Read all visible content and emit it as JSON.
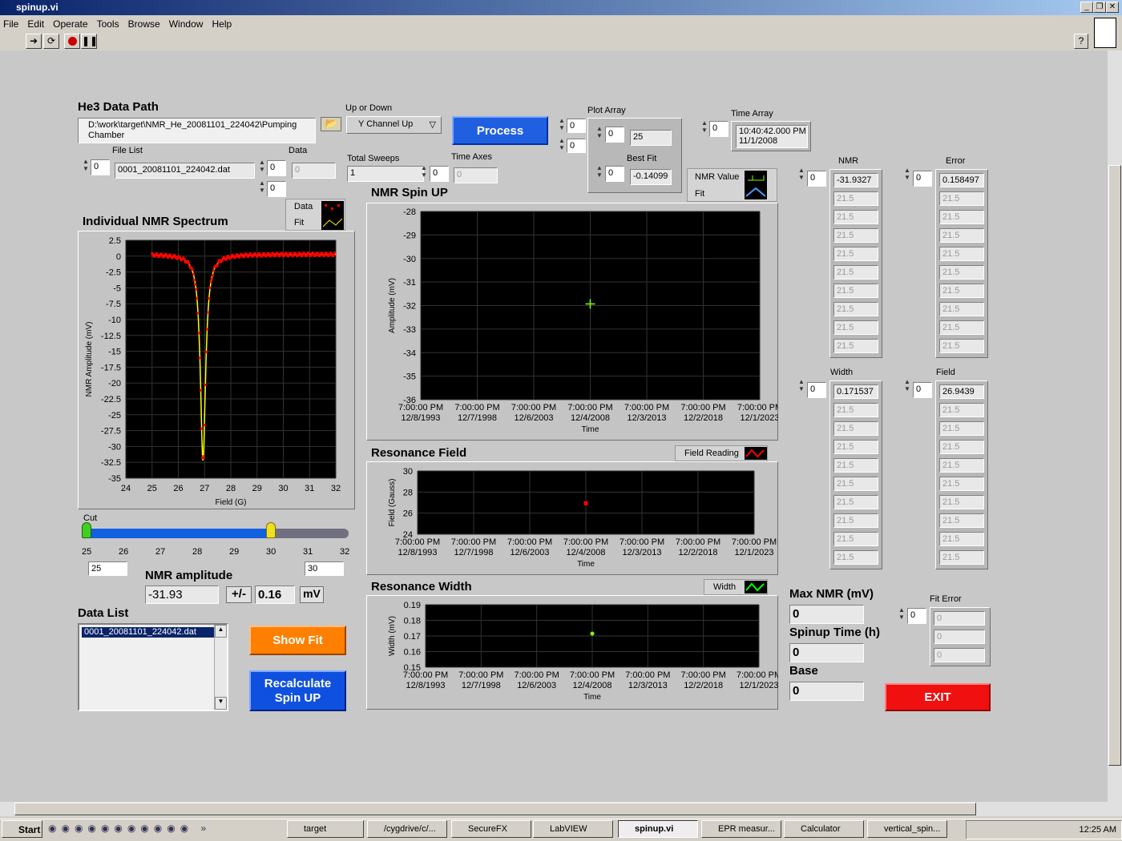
{
  "window": {
    "title": "spinup.vi",
    "min": "_",
    "max": "❐",
    "close": "✕"
  },
  "menu": [
    "File",
    "Edit",
    "Operate",
    "Tools",
    "Browse",
    "Window",
    "Help"
  ],
  "he3": {
    "title": "He3 Data Path",
    "path": "D:\\work\\target\\NMR_He_20081101_224042\\Pumping Chamber"
  },
  "file_list": {
    "label": "File List",
    "index": "0",
    "value": "0001_20081101_224042.dat"
  },
  "data_ctl": {
    "label": "Data",
    "i1": "0",
    "i2": "0",
    "value": "0"
  },
  "up_down": {
    "label": "Up or Down",
    "value": "Y Channel Up"
  },
  "total_sweeps": {
    "label": "Total Sweeps",
    "value": "1"
  },
  "time_axes": {
    "label": "Time Axes",
    "index": "0",
    "value": "0"
  },
  "process": "Process",
  "small_idx": [
    "0",
    "0"
  ],
  "plot_array": {
    "label": "Plot Array",
    "index": "0",
    "value": "25",
    "best_fit_label": "Best Fit",
    "bf_index": "0",
    "best_fit": "-0.14099"
  },
  "time_array": {
    "label": "Time Array",
    "index": "0",
    "value1": "10:40:42.000 PM",
    "value2": "11/1/2008"
  },
  "nmr_legend": {
    "a": "NMR Value",
    "b": "Fit"
  },
  "spectrum": {
    "title": "Individual NMR Spectrum",
    "legend_data": "Data",
    "legend_fit": "Fit",
    "xlabel": "Field (G)",
    "ylabel": "NMR Amplitude (mV)",
    "xticks": [
      "24",
      "25",
      "26",
      "27",
      "28",
      "29",
      "30",
      "31",
      "32"
    ],
    "yticks": [
      "2.5",
      "0",
      "-2.5",
      "-5",
      "-7.5",
      "-10",
      "-12.5",
      "-15",
      "-17.5",
      "-20",
      "-22.5",
      "-25",
      "-27.5",
      "-30",
      "-32.5",
      "-35"
    ]
  },
  "cut": {
    "label": "Cut",
    "ticks": [
      "25",
      "26",
      "27",
      "28",
      "29",
      "30",
      "31",
      "32"
    ],
    "low": "25",
    "high": "30"
  },
  "nmr_amp": {
    "label": "NMR amplitude",
    "value": "-31.93",
    "pm": "+/-",
    "err": "0.16",
    "unit": "mV"
  },
  "data_list": {
    "label": "Data List",
    "item": "0001_20081101_224042.dat"
  },
  "show_fit": "Show Fit",
  "recalc": [
    "Recalculate",
    "Spin UP"
  ],
  "spinup_chart": {
    "title": "NMR Spin UP",
    "ylabel": "Amplitude (mV)",
    "xlabel": "Time",
    "yticks": [
      "-28",
      "-29",
      "-30",
      "-31",
      "-32",
      "-33",
      "-34",
      "-35",
      "-36"
    ],
    "xticks": [
      [
        "7:00:00 PM",
        "12/8/1993"
      ],
      [
        "7:00:00 PM",
        "12/7/1998"
      ],
      [
        "7:00:00 PM",
        "12/6/2003"
      ],
      [
        "7:00:00 PM",
        "12/4/2008"
      ],
      [
        "7:00:00 PM",
        "12/3/2013"
      ],
      [
        "7:00:00 PM",
        "12/2/2018"
      ],
      [
        "7:00:00 PM",
        "12/1/2023"
      ]
    ]
  },
  "field_chart": {
    "title": "Resonance Field",
    "legend": "Field Reading",
    "ylabel": "Field (Gauss)",
    "xlabel": "Time",
    "yticks": [
      "30",
      "28",
      "26",
      "24"
    ]
  },
  "width_chart": {
    "title": "Resonance Width",
    "legend": "Width",
    "ylabel": "Width (mV)",
    "xlabel": "Time",
    "yticks": [
      "0.19",
      "0.18",
      "0.17",
      "0.16",
      "0.15"
    ]
  },
  "arrays": {
    "nmr": {
      "label": "NMR",
      "index": "0",
      "first": "-31.9327"
    },
    "error": {
      "label": "Error",
      "index": "0",
      "first": "0.158497"
    },
    "width": {
      "label": "Width",
      "index": "0",
      "first": "0.171537"
    },
    "field": {
      "label": "Field",
      "index": "0",
      "first": "26.9439"
    },
    "filler": "21.5"
  },
  "max_nmr": {
    "label": "Max NMR (mV)",
    "value": "0"
  },
  "spinup_time": {
    "label": "Spinup Time (h)",
    "value": "0"
  },
  "base": {
    "label": "Base",
    "value": "0"
  },
  "fit_error": {
    "label": "Fit Error",
    "index": "0",
    "values": [
      "0",
      "0",
      "0"
    ]
  },
  "exit": "EXIT",
  "taskbar": {
    "start": "Start",
    "tasks": [
      "target",
      "/cygdrive/c/...",
      "SecureFX",
      "LabVIEW",
      "spinup.vi",
      "EPR measur...",
      "Calculator",
      "vertical_spin..."
    ],
    "clock": "12:25 AM"
  }
}
